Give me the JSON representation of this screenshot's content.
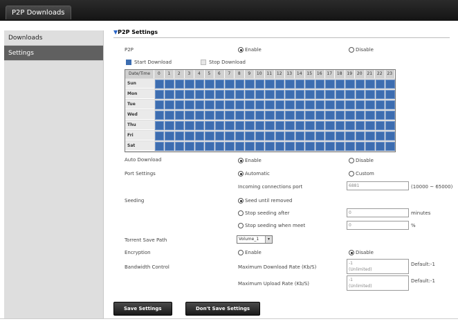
{
  "window": {
    "tab_title": "P2P Downloads"
  },
  "sidebar": {
    "items": [
      {
        "label": "Downloads"
      },
      {
        "label": "Settings"
      }
    ]
  },
  "section": {
    "title": "P2P Settings"
  },
  "p2p": {
    "label": "P2P",
    "enable": "Enable",
    "disable": "Disable",
    "selected": "enable"
  },
  "legend": {
    "start": "Start Download",
    "stop": "Stop Download",
    "start_color": "#3d6db0",
    "stop_color": "#e6e6e6"
  },
  "schedule": {
    "corner": "Date/Time",
    "hours": [
      "0",
      "1",
      "2",
      "3",
      "4",
      "5",
      "6",
      "7",
      "8",
      "9",
      "10",
      "11",
      "12",
      "13",
      "14",
      "15",
      "16",
      "17",
      "18",
      "19",
      "20",
      "21",
      "22",
      "23"
    ],
    "days": [
      "Sun",
      "Mon",
      "Tue",
      "Wed",
      "Thu",
      "Fri",
      "Sat"
    ]
  },
  "auto_download": {
    "label": "Auto Download",
    "enable": "Enable",
    "disable": "Disable",
    "selected": "enable"
  },
  "port": {
    "label": "Port Settings",
    "automatic": "Automatic",
    "custom": "Custom",
    "selected": "automatic",
    "incoming_label": "Incoming connections port",
    "incoming_value": "6881",
    "range": "(10000 ~ 65000)"
  },
  "seeding": {
    "label": "Seeding",
    "opt1": "Seed until removed",
    "opt2": "Stop seeding after",
    "opt3": "Stop seeding when meet",
    "after_value": "0",
    "after_unit": "minutes",
    "meet_value": "0",
    "meet_unit": "%",
    "selected": "opt1"
  },
  "save_path": {
    "label": "Torrent Save Path",
    "value": "Volume_1"
  },
  "encryption": {
    "label": "Encryption",
    "enable": "Enable",
    "disable": "Disable",
    "selected": "disable"
  },
  "bandwidth": {
    "label": "Bandwidth Control",
    "down_label": "Maximum Download Rate (Kb/S)",
    "down_value": "-1",
    "down_hint": "(Unlimited)",
    "down_default": "Default:-1",
    "up_label": "Maximum Upload Rate (Kb/S)",
    "up_value": "-1",
    "up_hint": "(Unlimited)",
    "up_default": "Default:-1"
  },
  "buttons": {
    "save": "Save Settings",
    "dont_save": "Don't Save Settings"
  }
}
